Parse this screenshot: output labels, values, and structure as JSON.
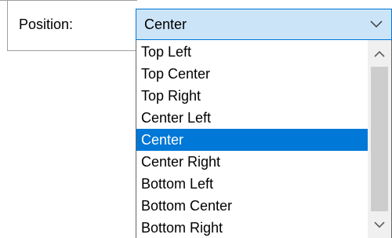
{
  "position_field": {
    "label": "Position:",
    "selected_value": "Center"
  },
  "dropdown": {
    "options": [
      "Top Left",
      "Top Center",
      "Top Right",
      "Center Left",
      "Center",
      "Center Right",
      "Bottom Left",
      "Bottom Center",
      "Bottom Right"
    ],
    "selected_index": 4
  },
  "icons": {
    "combo_arrow": "chevron-down-icon",
    "scroll_up": "scroll-up-arrow-icon",
    "scroll_down": "scroll-down-arrow-icon"
  },
  "colors": {
    "selection_bg": "#0078d7",
    "combo_bg": "#cce4f7",
    "combo_border": "#0078d7",
    "scrollbar_thumb": "#cdcdcd"
  }
}
